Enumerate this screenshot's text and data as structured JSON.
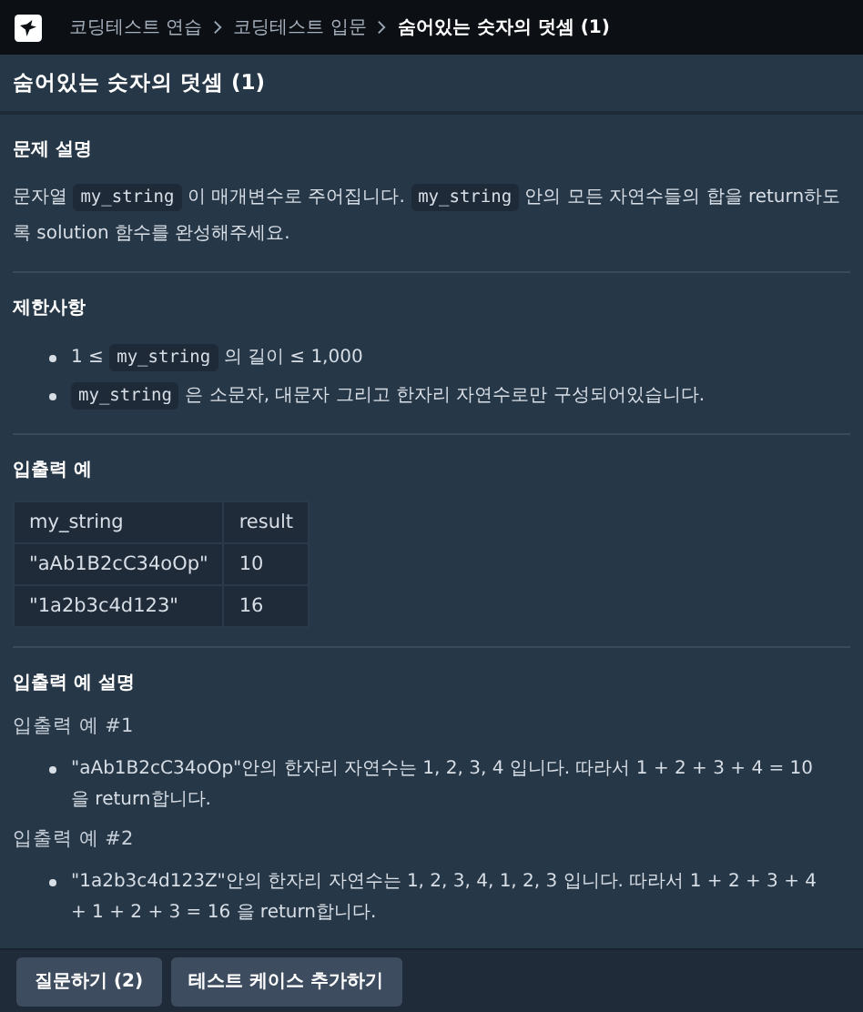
{
  "breadcrumb": [
    {
      "label": "코딩테스트 연습",
      "current": false
    },
    {
      "label": "코딩테스트 입문",
      "current": false
    },
    {
      "label": "숨어있는 숫자의 덧셈 (1)",
      "current": true
    }
  ],
  "title": "숨어있는 숫자의 덧셈 (1)",
  "description": {
    "heading": "문제 설명",
    "paragraph": [
      {
        "kind": "text",
        "text": "문자열 "
      },
      {
        "kind": "code",
        "text": "my_string"
      },
      {
        "kind": "text",
        "text": " 이 매개변수로 주어집니다. "
      },
      {
        "kind": "code",
        "text": "my_string"
      },
      {
        "kind": "text",
        "text": " 안의 모든 자연수들의 합을 return하도록 solution 함수를 완성해주세요."
      }
    ]
  },
  "constraints": {
    "heading": "제한사항",
    "items": [
      [
        {
          "kind": "text",
          "text": "1 ≤ "
        },
        {
          "kind": "code",
          "text": "my_string"
        },
        {
          "kind": "text",
          "text": " 의 길이 ≤ 1,000"
        }
      ],
      [
        {
          "kind": "code",
          "text": "my_string"
        },
        {
          "kind": "text",
          "text": " 은 소문자, 대문자 그리고 한자리 자연수로만 구성되어있습니다."
        }
      ]
    ]
  },
  "examples": {
    "heading": "입출력 예",
    "columns": [
      "my_string",
      "result"
    ],
    "rows": [
      [
        "\"aAb1B2cC34oOp\"",
        "10"
      ],
      [
        "\"1a2b3c4d123\"",
        "16"
      ]
    ]
  },
  "explanation": {
    "heading": "입출력 예 설명",
    "cases": [
      {
        "label": "입출력 예 #1",
        "text": "\"aAb1B2cC34oOp\"안의 한자리 자연수는 1, 2, 3, 4 입니다. 따라서 1 + 2 + 3 + 4 = 10 을 return합니다."
      },
      {
        "label": "입출력 예 #2",
        "text": "\"1a2b3c4d123Z\"안의 한자리 자연수는 1, 2, 3, 4, 1, 2, 3 입니다. 따라서 1 + 2 + 3 + 4 + 1 + 2 + 3 = 16 을 return합니다."
      }
    ]
  },
  "buttons": [
    "질문하기 (2)",
    "테스트 케이스 추가하기"
  ]
}
